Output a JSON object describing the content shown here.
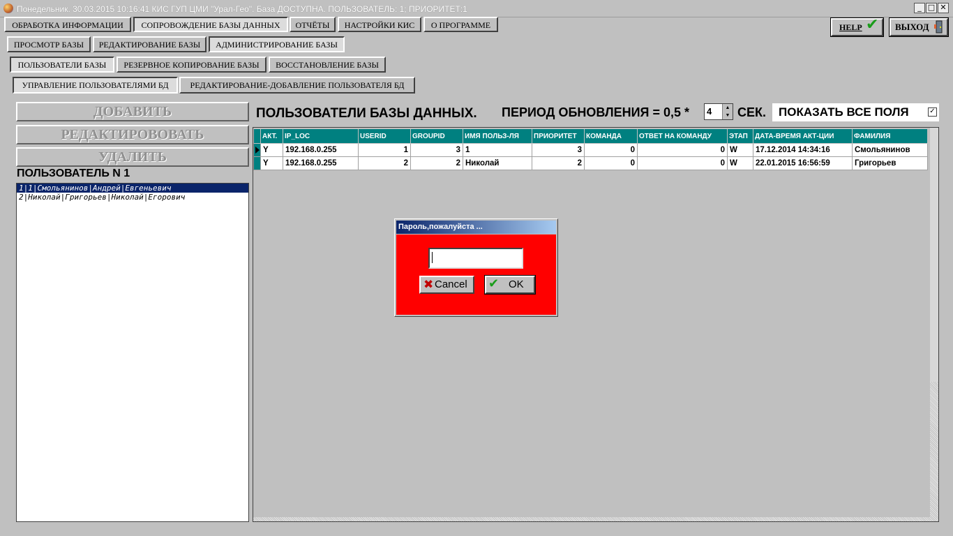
{
  "window": {
    "title": "Понедельник. 30.03.2015 10:16:41 КИС ГУП ЦМИ \"Урал-Гео\". База ДОСТУПНА. ПОЛЬЗОВАТЕЛЬ: 1; ПРИОРИТЕТ:1",
    "minimize": "_",
    "maximize": "□",
    "close": "✕"
  },
  "menu_row1": [
    "ОБРАБОТКА ИНФОРМАЦИИ",
    "СОПРОВОЖДЕНИЕ БАЗЫ ДАННЫХ",
    "ОТЧЁТЫ",
    "НАСТРОЙКИ КИС",
    "О ПРОГРАММЕ"
  ],
  "menu_row2": [
    "ПРОСМОТР БАЗЫ",
    "РЕДАКТИРОВАНИЕ БАЗЫ",
    "АДМИНИСТРИРОВАНИЕ БАЗЫ"
  ],
  "menu_row3": [
    "ПОЛЬЗОВАТЕЛИ БАЗЫ",
    "РЕЗЕРВНОЕ КОПИРОВАНИЕ БАЗЫ",
    "ВОССТАНОВЛЕНИЕ БАЗЫ"
  ],
  "menu_row4": [
    "УПРАВЛЕНИЕ ПОЛЬЗОВАТЕЛЯМИ БД",
    "РЕДАКТИРОВАНИЕ-ДОБАВЛЕНИЕ  ПОЛЬЗОВАТЕЛЯ БД"
  ],
  "help_label": "HELP",
  "exit_label": "ВЫХОД",
  "actions": {
    "add": "ДОБАВИТЬ",
    "edit": "РЕДАКТИРОВОВАТЬ",
    "delete": "УДАЛИТЬ"
  },
  "user_heading": "ПОЛЬЗОВАТЕЛЬ N 1",
  "user_list": [
    "1|1|Смольянинов|Андрей|Евгеньевич",
    "2|Николай|Григорьев|Николай|Егорович"
  ],
  "grid_title": "ПОЛЬЗОВАТЕЛИ БАЗЫ ДАННЫХ.",
  "refresh": {
    "label": "ПЕРИОД ОБНОВЛЕНИЯ = 0,5 *",
    "value": "4",
    "unit": "СЕК."
  },
  "show_all_label": "ПОКАЗАТЬ ВСЕ ПОЛЯ",
  "show_all_check": "✓",
  "table": {
    "columns": [
      "АКТ.",
      "IP_LOC",
      "USERID",
      "GROUPID",
      "ИМЯ ПОЛЬЗ-ЛЯ",
      "ПРИОРИТЕТ",
      "КОМАНДА",
      "ОТВЕТ НА КОМАНДУ",
      "ЭТАП",
      "ДАТА-ВРЕМЯ АКТ-ЦИИ",
      "ФАМИЛИЯ"
    ],
    "rows": [
      [
        "Y",
        "192.168.0.255",
        "1",
        "3",
        "1",
        "3",
        "0",
        "0",
        "W",
        "17.12.2014 14:34:16",
        "Смольянинов"
      ],
      [
        "Y",
        "192.168.0.255",
        "2",
        "2",
        "Николай",
        "2",
        "0",
        "0",
        "W",
        "22.01.2015 16:56:59",
        "Григорьев"
      ]
    ]
  },
  "dialog": {
    "title": "Пароль,пожалуйста ...",
    "password_value": "",
    "cancel_label": "Cancel",
    "ok_label": "OK"
  },
  "colors": {
    "accent_teal": "#008080",
    "dialog_bg": "#ff0000",
    "selection": "#0a246a"
  }
}
